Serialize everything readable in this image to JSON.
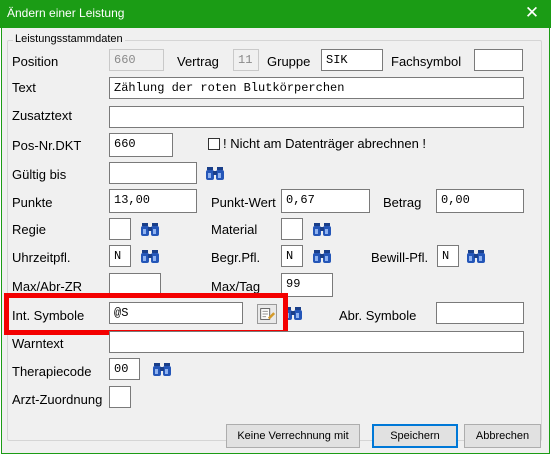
{
  "window": {
    "title": "Ändern einer Leistung",
    "close_glyph": "✕"
  },
  "group": {
    "legend": "Leistungsstammdaten"
  },
  "fields": {
    "position": {
      "label": "Position",
      "value": "660"
    },
    "vertrag": {
      "label": "Vertrag",
      "value": "11"
    },
    "gruppe": {
      "label": "Gruppe",
      "value": "SIK"
    },
    "fachsymbol": {
      "label": "Fachsymbol",
      "value": ""
    },
    "text": {
      "label": "Text",
      "value": "Zählung der roten Blutkörperchen"
    },
    "zusatztext": {
      "label": "Zusatztext",
      "value": ""
    },
    "pos_nr_dkt": {
      "label": "Pos-Nr.DKT",
      "value": "660"
    },
    "nicht_datentraeger": {
      "label": "! Nicht am Datenträger abrechnen !",
      "checked": false
    },
    "gueltig_bis": {
      "label": "Gültig bis",
      "value": ""
    },
    "punkte": {
      "label": "Punkte",
      "value": "13,00"
    },
    "punkt_wert": {
      "label": "Punkt-Wert",
      "value": "0,67"
    },
    "betrag": {
      "label": "Betrag",
      "value": "0,00"
    },
    "regie": {
      "label": "Regie",
      "value": ""
    },
    "material": {
      "label": "Material",
      "value": ""
    },
    "uhrzeitpfl": {
      "label": "Uhrzeitpfl.",
      "value": "N"
    },
    "begr_pfl": {
      "label": "Begr.Pfl.",
      "value": "N"
    },
    "bewill_pfl": {
      "label": "Bewill-Pfl.",
      "value": "N"
    },
    "max_abr_zr": {
      "label": "Max/Abr-ZR",
      "value": ""
    },
    "max_tag": {
      "label": "Max/Tag",
      "value": "99"
    },
    "int_symbole": {
      "label": "Int. Symbole",
      "value": "@S"
    },
    "abr_symbole": {
      "label": "Abr. Symbole",
      "value": ""
    },
    "warntext": {
      "label": "Warntext",
      "value": ""
    },
    "therapiecode": {
      "label": "Therapiecode",
      "value": "00"
    },
    "arzt_zuordnung": {
      "label": "Arzt-Zuordnung",
      "value": ""
    }
  },
  "buttons": {
    "keine_verrechnung": "Keine Verrechnung mit",
    "speichern": "Speichern",
    "abbrechen": "Abbrechen"
  },
  "colors": {
    "titlebar": "#1b9c15",
    "highlight": "#f40000",
    "dialog_bg": "#f0f0f0"
  },
  "icons": [
    "binoculars-icon",
    "edit-picker-icon",
    "close-icon"
  ]
}
